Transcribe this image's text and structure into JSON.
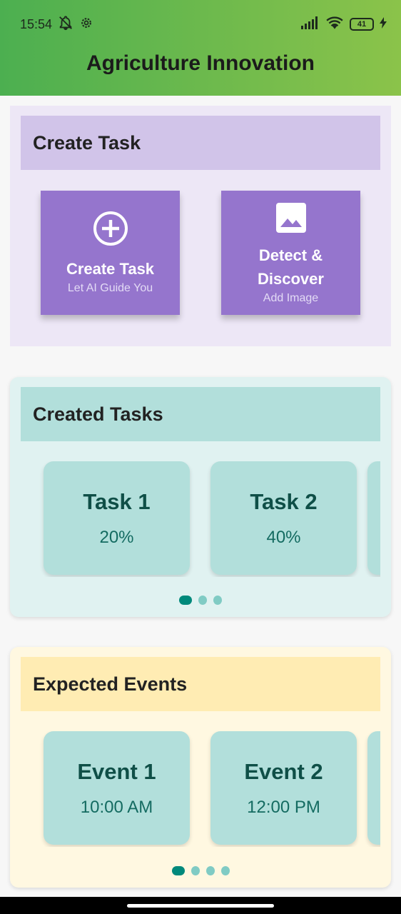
{
  "status": {
    "time": "15:54",
    "battery": "41",
    "icons": [
      "notification-muted-icon",
      "settings-gear-icon",
      "signal-icon",
      "wifi-icon",
      "battery-icon",
      "charging-icon"
    ]
  },
  "app": {
    "title": "Agriculture Innovation"
  },
  "create_section": {
    "title": "Create Task",
    "actions": [
      {
        "title": "Create Task",
        "subtitle": "Let AI Guide You",
        "icon": "add-circle-icon"
      },
      {
        "title": "Detect & Discover",
        "subtitle": "Add Image",
        "icon": "image-icon"
      }
    ]
  },
  "tasks_section": {
    "title": "Created Tasks",
    "items": [
      {
        "title": "Task 1",
        "value": "20%"
      },
      {
        "title": "Task 2",
        "value": "40%"
      }
    ],
    "page_count": 3,
    "active_page": 1
  },
  "events_section": {
    "title": "Expected Events",
    "items": [
      {
        "title": "Event 1",
        "value": "10:00 AM"
      },
      {
        "title": "Event 2",
        "value": "12:00 PM"
      }
    ],
    "page_count": 4,
    "active_page": 1
  },
  "colors": {
    "appbar_start": "#4caf50",
    "appbar_end": "#8bc34a",
    "accent_purple": "#9575cd",
    "teal_dark": "#00897b"
  }
}
